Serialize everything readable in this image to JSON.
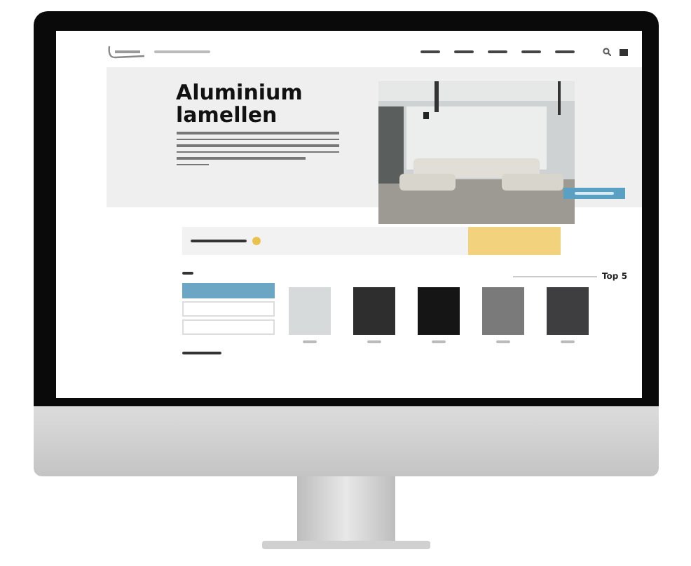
{
  "hero": {
    "title": "Aluminium lamellen"
  },
  "products": {
    "heading": "Top 5"
  },
  "filter_list": [
    {
      "selected": true
    },
    {
      "selected": false
    },
    {
      "selected": false
    }
  ],
  "swatches": [
    {
      "color": "#d6dadb"
    },
    {
      "color": "#2e2e2e"
    },
    {
      "color": "#151515"
    },
    {
      "color": "#7a7a7a"
    },
    {
      "color": "#3e3e40"
    }
  ]
}
